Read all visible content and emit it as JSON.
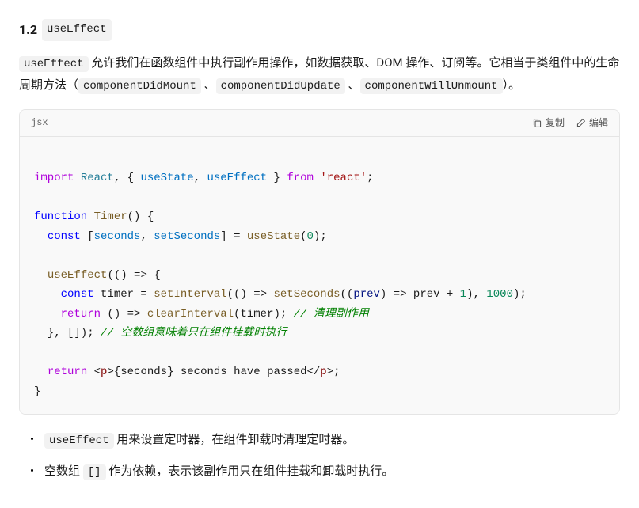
{
  "heading": {
    "number": "1.2",
    "code": "useEffect"
  },
  "intro": {
    "code1": "useEffect",
    "text1": " 允许我们在函数组件中执行副作用操作，如数据获取、DOM 操作、订阅等。它相当于类组件中的生命周期方法（",
    "code2": "componentDidMount",
    "sep1": " 、",
    "code3": "componentDidUpdate",
    "sep2": " 、",
    "code4": "componentWillUnmount",
    "text2": "）。"
  },
  "codeblock": {
    "lang": "jsx",
    "copy_label": "复制",
    "edit_label": "编辑"
  },
  "code": {
    "l1_import": "import",
    "l1_react": "React",
    "l1_comma": ", { ",
    "l1_usestate": "useState",
    "l1_comma2": ", ",
    "l1_useeffect": "useEffect",
    "l1_brace": " } ",
    "l1_from": "from",
    "l1_str": "'react'",
    "l1_semi": ";",
    "l3_function": "function",
    "l3_name": "Timer",
    "l3_parens": "() {",
    "l4_const": "const",
    "l4_arr": " [",
    "l4_seconds": "seconds",
    "l4_comma": ", ",
    "l4_setseconds": "setSeconds",
    "l4_close": "] = ",
    "l4_usestate": "useState",
    "l4_open": "(",
    "l4_zero": "0",
    "l4_end": ");",
    "l6_useeffect": "useEffect",
    "l6_rest": "(() => {",
    "l7_const": "const",
    "l7_timer": " timer = ",
    "l7_setinterval": "setInterval",
    "l7_open": "(() => ",
    "l7_setseconds": "setSeconds",
    "l7_prev": "((",
    "l7_prevvar": "prev",
    "l7_arrow": ") => prev + ",
    "l7_one": "1",
    "l7_close1": "), ",
    "l7_thousand": "1000",
    "l7_end": ");",
    "l8_return": "return",
    "l8_arrow": " () => ",
    "l8_clear": "clearInterval",
    "l8_args": "(timer); ",
    "l8_comment": "// 清理副作用",
    "l9_close": "  }, []); ",
    "l9_comment": "// 空数组意味着只在组件挂载时执行",
    "l11_return": "return",
    "l11_open": " <",
    "l11_p1": "p",
    "l11_mid1": ">{seconds} seconds have passed</",
    "l11_p2": "p",
    "l11_close": ">;",
    "l12_brace": "}"
  },
  "bullets": {
    "b1_code": "useEffect",
    "b1_text": " 用来设置定时器，在组件卸载时清理定时器。",
    "b2_text1": "空数组 ",
    "b2_code": "[]",
    "b2_text2": " 作为依赖，表示该副作用只在组件挂载和卸载时执行。"
  }
}
